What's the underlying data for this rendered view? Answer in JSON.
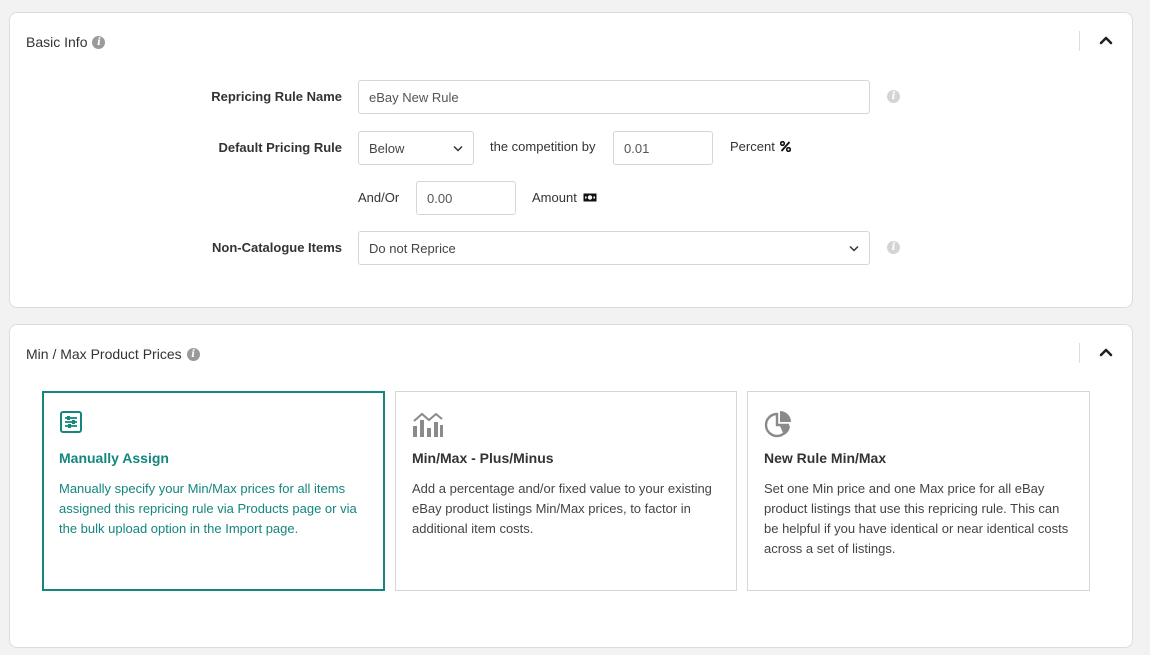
{
  "basic_info": {
    "title": "Basic Info",
    "rule_name_label": "Repricing Rule Name",
    "rule_name_value": "eBay New Rule",
    "default_pricing_label": "Default Pricing Rule",
    "direction_value": "Below",
    "competition_text": "the competition by",
    "percent_value": "0.01",
    "percent_label": "Percent",
    "andor_text": "And/Or",
    "amount_value": "0.00",
    "amount_label": "Amount",
    "non_catalogue_label": "Non-Catalogue Items",
    "non_catalogue_value": "Do not Reprice"
  },
  "minmax": {
    "title": "Min / Max Product Prices",
    "cards": [
      {
        "title": "Manually Assign",
        "desc": "Manually specify your Min/Max prices for all items assigned this repricing rule via Products page or via the bulk upload option in the Import page.",
        "icon": "sliders-icon",
        "selected": true
      },
      {
        "title": "Min/Max - Plus/Minus",
        "desc": "Add a percentage and/or fixed value to your existing eBay product listings Min/Max prices, to factor in additional item costs.",
        "icon": "bar-chart-icon",
        "selected": false
      },
      {
        "title": "New Rule Min/Max",
        "desc": "Set one Min price and one Max price for all eBay product listings that use this repricing rule. This can be helpful if you have identical or near identical costs across a set of listings.",
        "icon": "pie-chart-icon",
        "selected": false
      }
    ]
  },
  "colors": {
    "accent": "#14867e",
    "border": "#d6d6d6"
  }
}
